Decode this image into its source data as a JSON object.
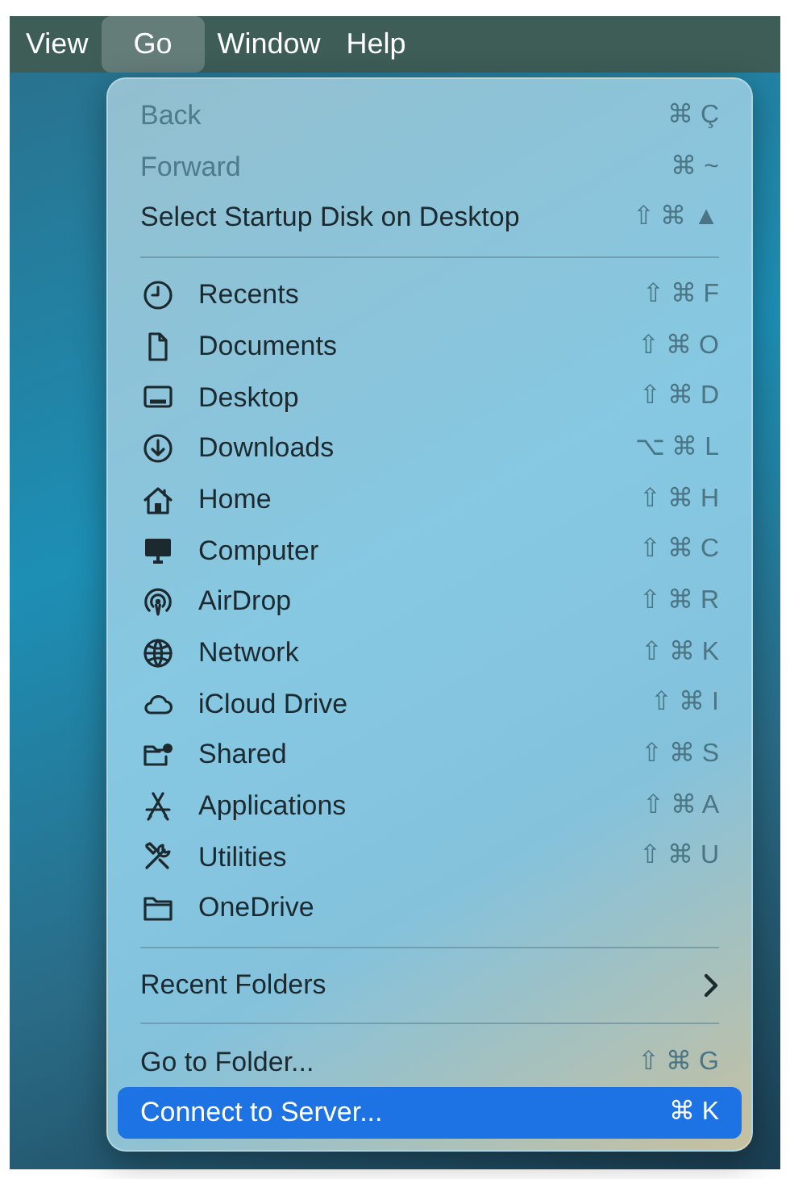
{
  "menu_bar": [
    {
      "label": "View",
      "selected": false
    },
    {
      "label": "Go",
      "selected": true
    },
    {
      "label": "Window",
      "selected": false
    },
    {
      "label": "Help",
      "selected": false
    }
  ],
  "menu": {
    "sections": [
      [
        {
          "kind": "plain",
          "label": "Back",
          "shortcut": "⌘ Ç",
          "disabled": true,
          "selected": false
        },
        {
          "kind": "plain",
          "label": "Forward",
          "shortcut": "⌘ ~",
          "disabled": true,
          "selected": false
        },
        {
          "kind": "plain",
          "label": "Select Startup Disk on Desktop",
          "shortcut": "⇧ ⌘ ▲",
          "disabled": false,
          "selected": false
        }
      ],
      [
        {
          "kind": "folder",
          "label": "Recents",
          "shortcut": "⇧ ⌘ F",
          "disabled": false,
          "selected": false
        },
        {
          "kind": "folder",
          "label": "Documents",
          "shortcut": "⇧ ⌘ O",
          "disabled": false,
          "selected": false
        },
        {
          "kind": "folder",
          "label": "Desktop",
          "shortcut": "⇧ ⌘ D",
          "disabled": false,
          "selected": false
        },
        {
          "kind": "folder",
          "label": "Downloads",
          "shortcut": "⌥ ⌘ L",
          "disabled": false,
          "selected": false
        },
        {
          "kind": "folder",
          "label": "Home",
          "shortcut": "⇧ ⌘ H",
          "disabled": false,
          "selected": false
        },
        {
          "kind": "folder",
          "label": "Computer",
          "shortcut": "⇧ ⌘ C",
          "disabled": false,
          "selected": false
        },
        {
          "kind": "folder",
          "label": "AirDrop",
          "shortcut": "⇧ ⌘ R",
          "disabled": false,
          "selected": false
        },
        {
          "kind": "folder",
          "label": "Network",
          "shortcut": "⇧ ⌘ K",
          "disabled": false,
          "selected": false
        },
        {
          "kind": "folder",
          "label": "iCloud Drive",
          "shortcut": "⇧ ⌘ I",
          "disabled": false,
          "selected": false
        },
        {
          "kind": "folder",
          "label": "Shared",
          "shortcut": "⇧ ⌘ S",
          "disabled": false,
          "selected": false
        },
        {
          "kind": "folder",
          "label": "Applications",
          "shortcut": "⇧ ⌘ A",
          "disabled": false,
          "selected": false
        },
        {
          "kind": "folder",
          "label": "Utilities",
          "shortcut": "⇧ ⌘ U",
          "disabled": false,
          "selected": false
        },
        {
          "kind": "folder",
          "label": "OneDrive",
          "disabled": false,
          "selected": false
        }
      ],
      [
        {
          "kind": "submenu",
          "label": "Recent Folders",
          "disabled": false,
          "selected": false
        }
      ],
      [
        {
          "kind": "plain",
          "label": "Go to Folder...",
          "shortcut": "⇧ ⌘ G",
          "disabled": false,
          "selected": false
        },
        {
          "kind": "plain",
          "label": "Connect to Server...",
          "shortcut": "⌘ K",
          "disabled": false,
          "selected": true
        }
      ]
    ]
  }
}
